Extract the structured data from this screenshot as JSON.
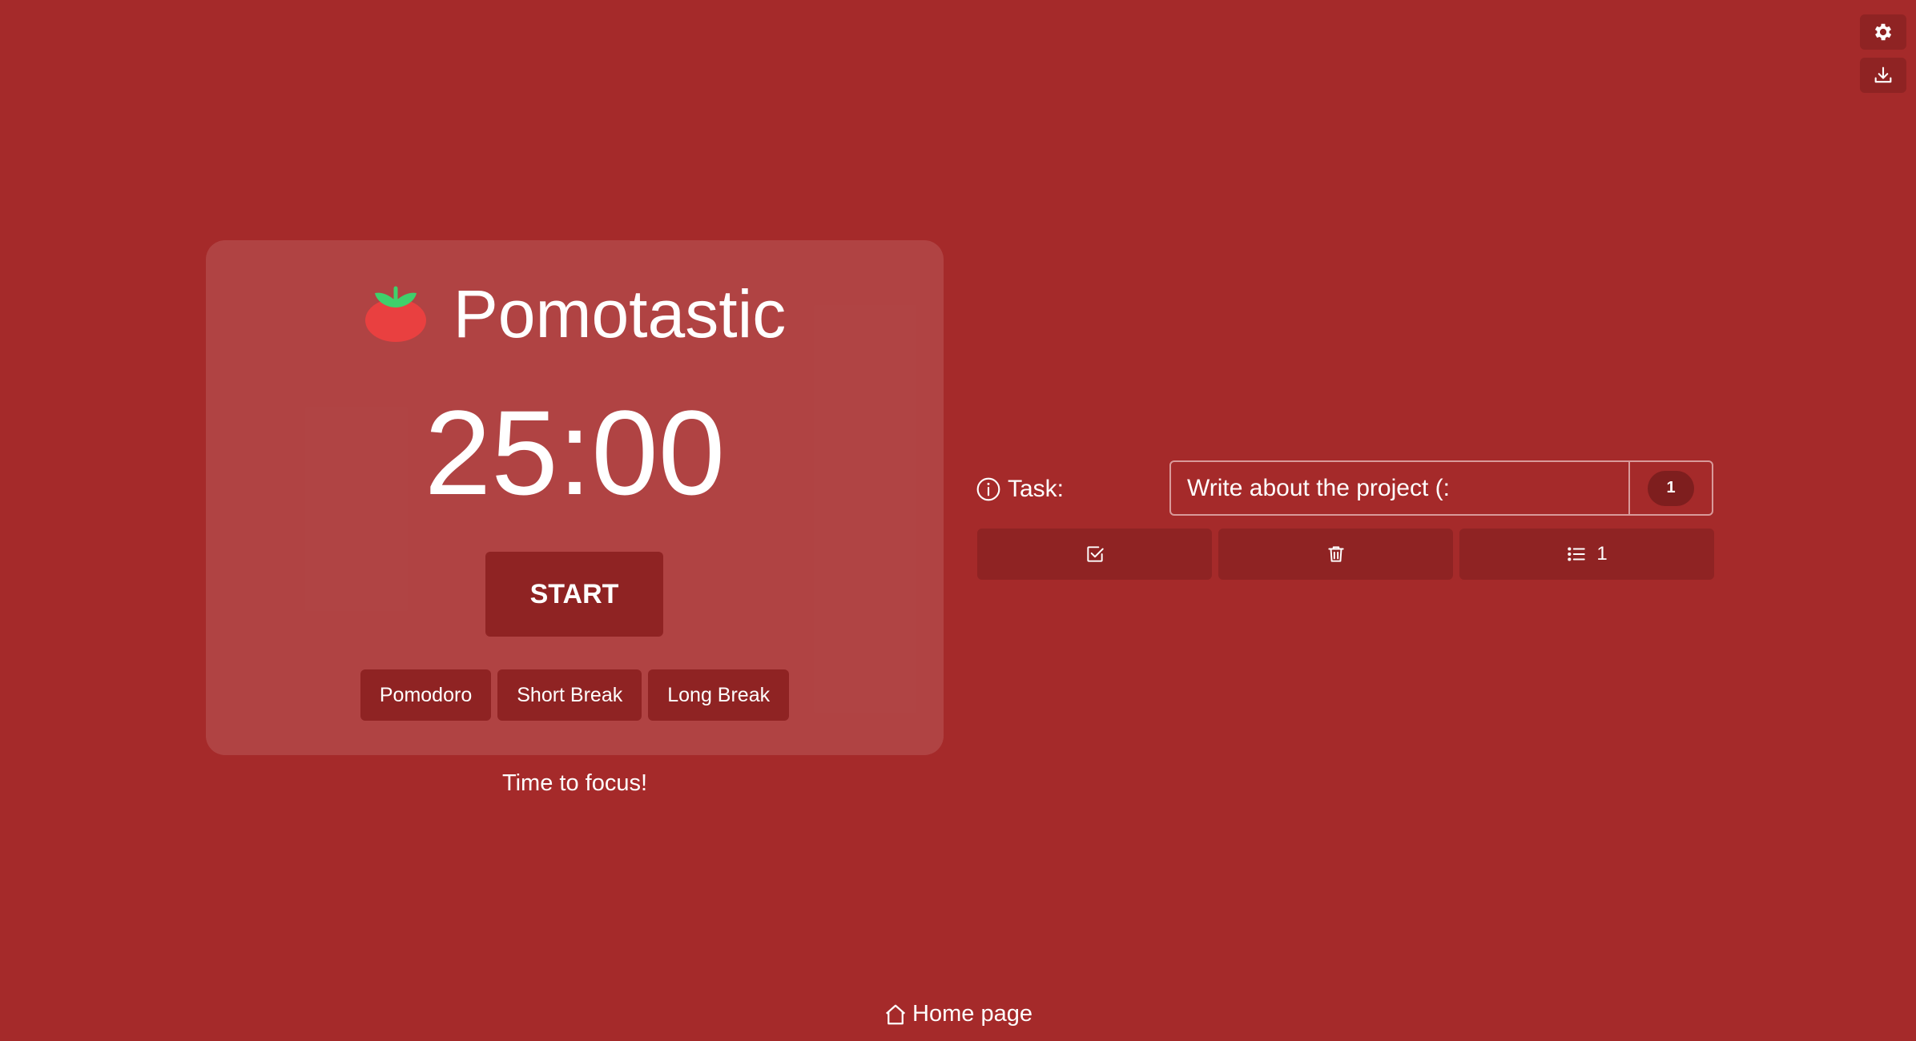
{
  "app": {
    "title": "Pomotastic",
    "logo_icon": "tomato-icon"
  },
  "colors": {
    "background": "#a52a2a",
    "card": "#b04646",
    "button": "#8f2323",
    "badge": "#7e1e1e",
    "tomato_red": "#e94040",
    "tomato_leaf": "#3fd06b"
  },
  "top_actions": [
    {
      "icon": "gear-icon"
    },
    {
      "icon": "download-icon"
    }
  ],
  "timer": {
    "display": "25:00",
    "start_label": "START",
    "modes": [
      "Pomodoro",
      "Short Break",
      "Long Break"
    ],
    "message": "Time to focus!"
  },
  "task": {
    "label": "Task:",
    "value": "Write about the project (:",
    "count": "1",
    "actions": {
      "complete_icon": "check-square-icon",
      "delete_icon": "trash-icon",
      "list_icon": "list-icon",
      "list_count": "1"
    }
  },
  "footer": {
    "home_label": "Home page"
  }
}
